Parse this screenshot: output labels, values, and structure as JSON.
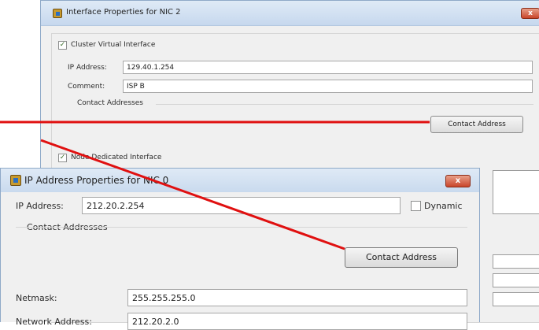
{
  "back_dialog": {
    "title": "Interface Properties for NIC 2",
    "close_glyph": "x",
    "cluster_virtual_interface": {
      "checked": true,
      "label": "Cluster Virtual Interface"
    },
    "ip_address": {
      "label": "IP Address:",
      "value": "129.40.1.254"
    },
    "comment": {
      "label": "Comment:",
      "value": "ISP B"
    },
    "contact_addresses_label": "Contact Addresses",
    "contact_address_button": "Contact Address",
    "node_dedicated_interface": {
      "checked": true,
      "label": "Node Dedicated Interface"
    }
  },
  "front_dialog": {
    "title": "IP Address Properties for NIC 0",
    "close_glyph": "x",
    "ip_address": {
      "label": "IP Address:",
      "value": "212.20.2.254"
    },
    "dynamic": {
      "checked": false,
      "label": "Dynamic"
    },
    "contact_addresses_label": "Contact Addresses",
    "contact_address_button": "Contact Address",
    "netmask": {
      "label": "Netmask:",
      "value": "255.255.255.0"
    },
    "network_address": {
      "label": "Network Address:",
      "value": "212.20.2.0"
    }
  },
  "colors": {
    "annotation": "#e01010",
    "titlebar": "#c9daee",
    "close_button": "#c9452a"
  }
}
